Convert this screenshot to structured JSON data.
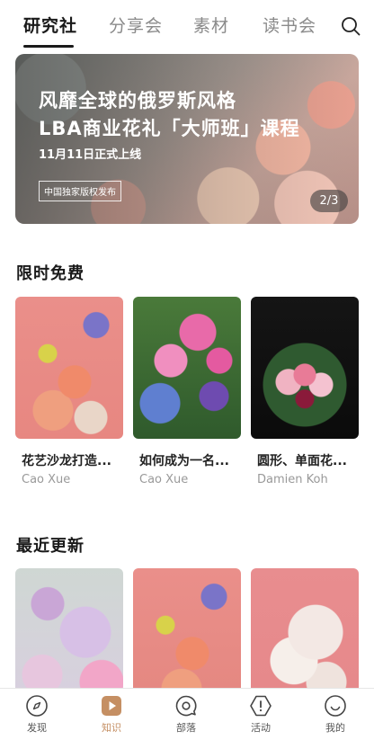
{
  "tabs": [
    {
      "label": "研究社",
      "active": true
    },
    {
      "label": "分享会",
      "active": false
    },
    {
      "label": "素材",
      "active": false
    },
    {
      "label": "读书会",
      "active": false
    }
  ],
  "search_icon": "search-icon",
  "banner": {
    "title_line1": "风靡全球的俄罗斯风格",
    "title_line2": "LBA商业花礼「大师班」课程",
    "subtitle": "11月11日正式上线",
    "tag": "中国独家版权发布",
    "pager": "2/3"
  },
  "sections": {
    "free": {
      "title": "限时免费",
      "cards": [
        {
          "title": "花艺沙龙打造...",
          "author": "Cao Xue"
        },
        {
          "title": "如何成为一名...",
          "author": "Cao Xue"
        },
        {
          "title": "圆形、单面花...",
          "author": "Damien Koh"
        }
      ]
    },
    "recent": {
      "title": "最近更新"
    }
  },
  "nav": [
    {
      "label": "发现",
      "icon": "compass-icon",
      "active": false
    },
    {
      "label": "知识",
      "icon": "play-icon",
      "active": true
    },
    {
      "label": "部落",
      "icon": "chat-bubble-icon",
      "active": false
    },
    {
      "label": "活动",
      "icon": "alert-hexagon-icon",
      "active": false
    },
    {
      "label": "我的",
      "icon": "smile-face-icon",
      "active": false
    }
  ],
  "colors": {
    "accent": "#c58f63",
    "text_primary": "#1a1a1a",
    "text_secondary": "#999999"
  }
}
